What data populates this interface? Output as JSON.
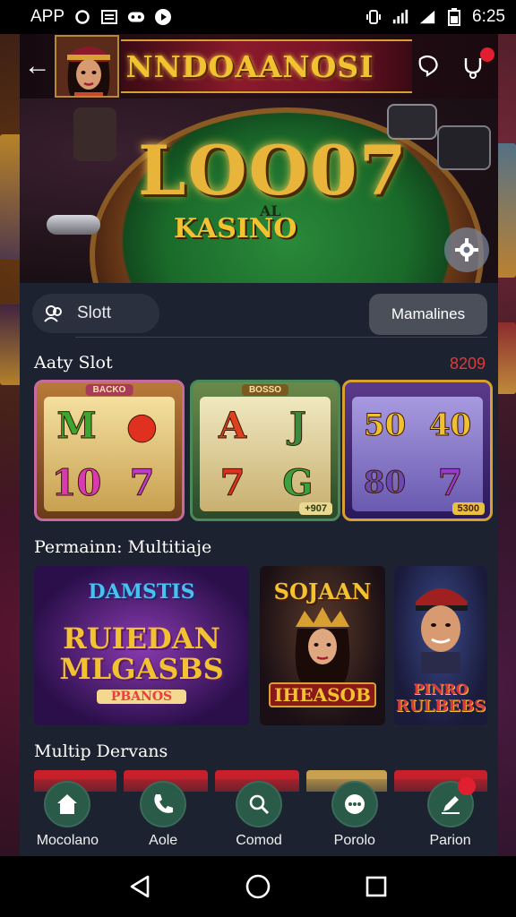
{
  "status_bar": {
    "app_label": "APP",
    "time": "6:25"
  },
  "header": {
    "title": "NNDOAANOSI"
  },
  "hero": {
    "logo": "LOO07",
    "sub_small": "AL",
    "sub_large": "KASINO"
  },
  "search": {
    "slot_label": "Slott",
    "right_button_label": "Mamalines"
  },
  "section_slots": {
    "title": "Aaty Slot",
    "count": "8209",
    "cards": [
      {
        "tag": "BACKO",
        "symbols": [
          "M",
          "🍒",
          "10",
          "7"
        ],
        "badge": ""
      },
      {
        "tag": "BOSSO",
        "symbols": [
          "A",
          "J",
          "7",
          "G"
        ],
        "badge": "+907"
      },
      {
        "tag": "",
        "symbols": [
          "50",
          "40",
          "80",
          "7"
        ],
        "badge": "5300"
      }
    ]
  },
  "section_promos": {
    "title": "Permainn: Multitiaje",
    "cards": [
      {
        "top": "DAMSTIS",
        "main1": "RUIEDAN",
        "main2": "MLGASBS",
        "sub": "PBANOS"
      },
      {
        "top": "SOJAAN",
        "main1": "IHEASOB",
        "main2": "",
        "sub": ""
      },
      {
        "top": "",
        "main1": "PINRO",
        "main2": "RULBEBS",
        "sub": ""
      }
    ]
  },
  "section_multi": {
    "title": "Multip Dervans"
  },
  "bottom_nav": [
    {
      "label": "Mocolano",
      "icon": "home-icon"
    },
    {
      "label": "Aole",
      "icon": "phone-icon"
    },
    {
      "label": "Comod",
      "icon": "search-icon"
    },
    {
      "label": "Porolo",
      "icon": "chat-icon"
    },
    {
      "label": "Parion",
      "icon": "pen-icon"
    }
  ],
  "colors": {
    "accent_gold": "#f2c230",
    "count_red": "#e03a3a",
    "nav_green": "#2a5a48"
  }
}
